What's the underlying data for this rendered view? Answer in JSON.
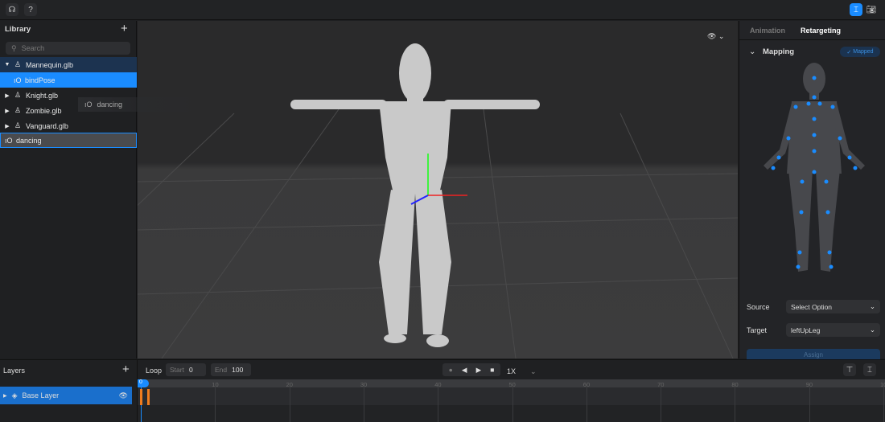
{
  "topbar": {
    "help_label": "?"
  },
  "library": {
    "title": "Library",
    "search_placeholder": "Search",
    "items": [
      {
        "label": "Mannequin.glb",
        "type": "model",
        "expanded": true
      },
      {
        "label": "bindPose",
        "type": "animation",
        "selected": true
      },
      {
        "label": "Knight.glb",
        "type": "model"
      },
      {
        "label": "Zombie.glb",
        "type": "model"
      },
      {
        "label": "Vanguard.glb",
        "type": "model"
      },
      {
        "label": "dancing",
        "type": "animation"
      }
    ],
    "drag_ghost": "dancing"
  },
  "right_panel": {
    "tabs": [
      {
        "label": "Animation",
        "active": false
      },
      {
        "label": "Retargeting",
        "active": true
      }
    ],
    "section_title": "Mapping",
    "badge": "Mapped",
    "source_label": "Source",
    "source_value": "Select Option",
    "target_label": "Target",
    "target_value": "leftUpLeg",
    "assign_label": "Assign"
  },
  "layers": {
    "title": "Layers",
    "items": [
      {
        "label": "Base Layer",
        "visible": true
      }
    ]
  },
  "timeline": {
    "loop_label": "Loop",
    "start_label": "Start",
    "start_value": "0",
    "end_label": "End",
    "end_value": "100",
    "speed": "1X",
    "ticks": [
      "0",
      "10",
      "20",
      "30",
      "40",
      "50",
      "60",
      "70",
      "80",
      "90",
      "100"
    ],
    "current_frame": 0
  },
  "colors": {
    "accent": "#1a8cff",
    "keyframe": "#f07c1e"
  }
}
